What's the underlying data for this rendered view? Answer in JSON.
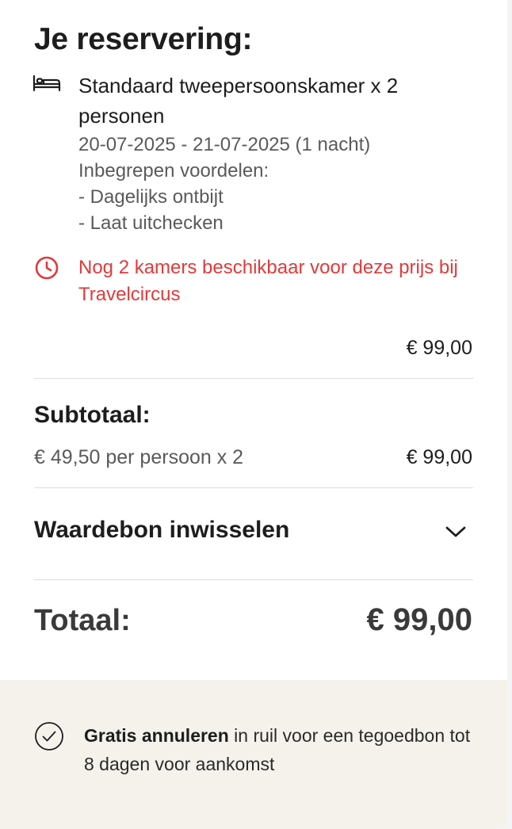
{
  "reservation": {
    "title": "Je reservering:",
    "room_name": "Standaard tweepersoonskamer x 2 personen",
    "dates": "20-07-2025 - 21-07-2025 (1 nacht)",
    "benefits_heading": "Inbegrepen voordelen:",
    "benefits": [
      "- Dagelijks ontbijt",
      "- Laat uitchecken"
    ],
    "availability_alert": "Nog 2 kamers beschikbaar voor deze prijs bij Travelcircus",
    "room_price": "€ 99,00"
  },
  "subtotal": {
    "label": "Subtotaal:",
    "description": "€ 49,50 per persoon x 2",
    "price": "€ 99,00"
  },
  "voucher": {
    "label": "Waardebon inwisselen"
  },
  "total": {
    "label": "Totaal:",
    "price": "€ 99,00"
  },
  "cancellation": {
    "bold": "Gratis annuleren",
    "rest": " in ruil voor een tegoedbon tot 8 dagen voor aankomst"
  },
  "icons": {
    "room": "bed-icon",
    "alert": "clock-icon",
    "voucher_toggle": "chevron-down-icon",
    "cancellation": "check-circle-icon"
  },
  "colors": {
    "alert": "#e23a3a",
    "footer_background": "#f5f2ec"
  }
}
